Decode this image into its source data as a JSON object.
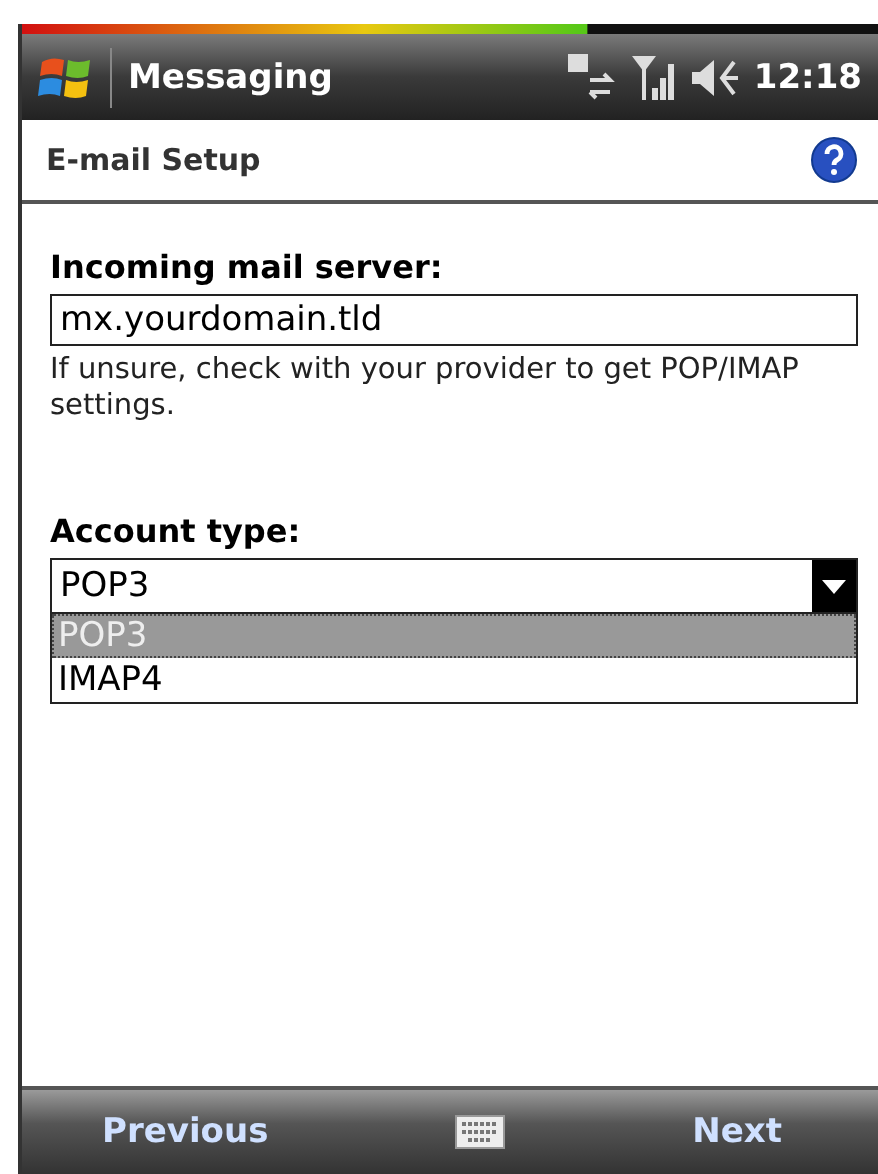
{
  "title_bar": {
    "title": "Messaging",
    "time": "12:18"
  },
  "header": {
    "title": "E-mail Setup"
  },
  "server": {
    "label": "Incoming mail server:",
    "value": "mx.yourdomain.tld",
    "hint": "If unsure, check with your provider to get POP/IMAP settings."
  },
  "account_type": {
    "label": "Account type:",
    "value": "POP3",
    "expanded": true,
    "options": [
      {
        "label": "POP3",
        "selected": true
      },
      {
        "label": "IMAP4",
        "selected": false
      }
    ]
  },
  "soft_keys": {
    "left": "Previous",
    "right": "Next"
  }
}
